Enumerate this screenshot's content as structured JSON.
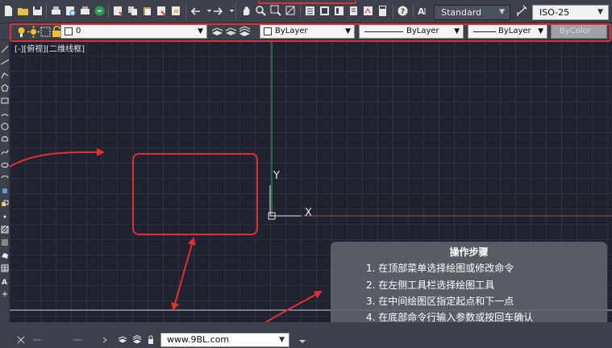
{
  "toolbar": {
    "text_style": "Standard",
    "dim_style": "ISO-25"
  },
  "layer_bar": {
    "current_layer": "0",
    "color": "ByLayer",
    "linetype": "ByLayer",
    "lineweight": "ByLayer",
    "plot_style": "ByColor"
  },
  "canvas": {
    "view_label": "[-][俯视][二维线框]",
    "axis_y_label": "Y",
    "axis_x_label": "X"
  },
  "info_panel": {
    "title": "操作步骤",
    "steps": [
      "1. 在顶部菜单选择绘图或修改命令",
      "2. 在左侧工具栏选择绘图工具",
      "3. 在中间绘图区指定起点和下一点",
      "4. 在底部命令行输入参数或按回车确认"
    ]
  },
  "bottom_bar": {
    "url": "www.9BL.com"
  },
  "colors": {
    "highlight_red": "#e23030",
    "ucs_x_axis": "#c0393b",
    "ucs_y_axis": "#3fa54a"
  }
}
